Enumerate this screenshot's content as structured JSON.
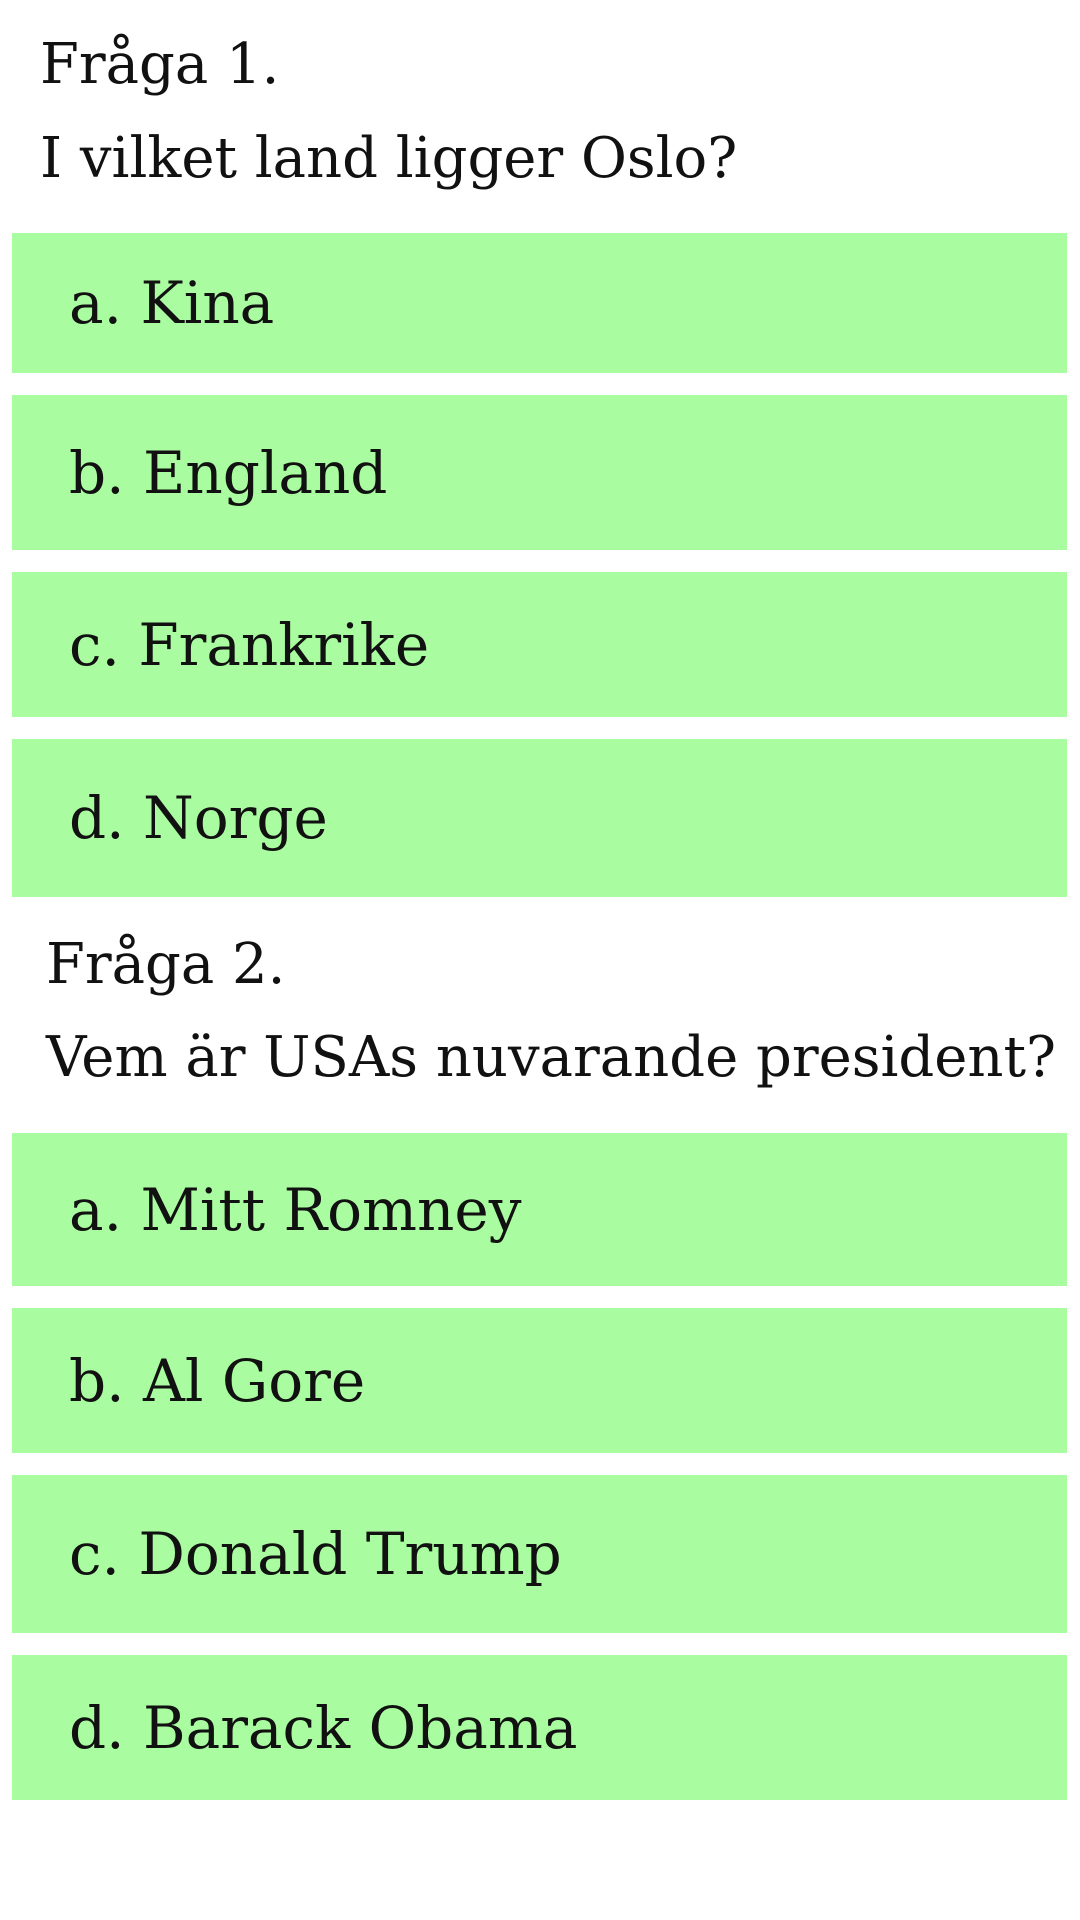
{
  "questions": [
    {
      "title": "Fråga 1.",
      "text": "I vilket land ligger Oslo?",
      "options": [
        "a. Kina",
        "b. England",
        "c. Frankrike",
        "d. Norge"
      ]
    },
    {
      "title": "Fråga 2.",
      "text": "Vem är USAs nuvarande president?",
      "options": [
        "a. Mitt Romney",
        "b. Al Gore",
        "c. Donald Trump",
        "d. Barack Obama"
      ]
    }
  ],
  "colors": {
    "option_background": "#aafca0",
    "text": "#111111",
    "page_background": "#ffffff"
  }
}
